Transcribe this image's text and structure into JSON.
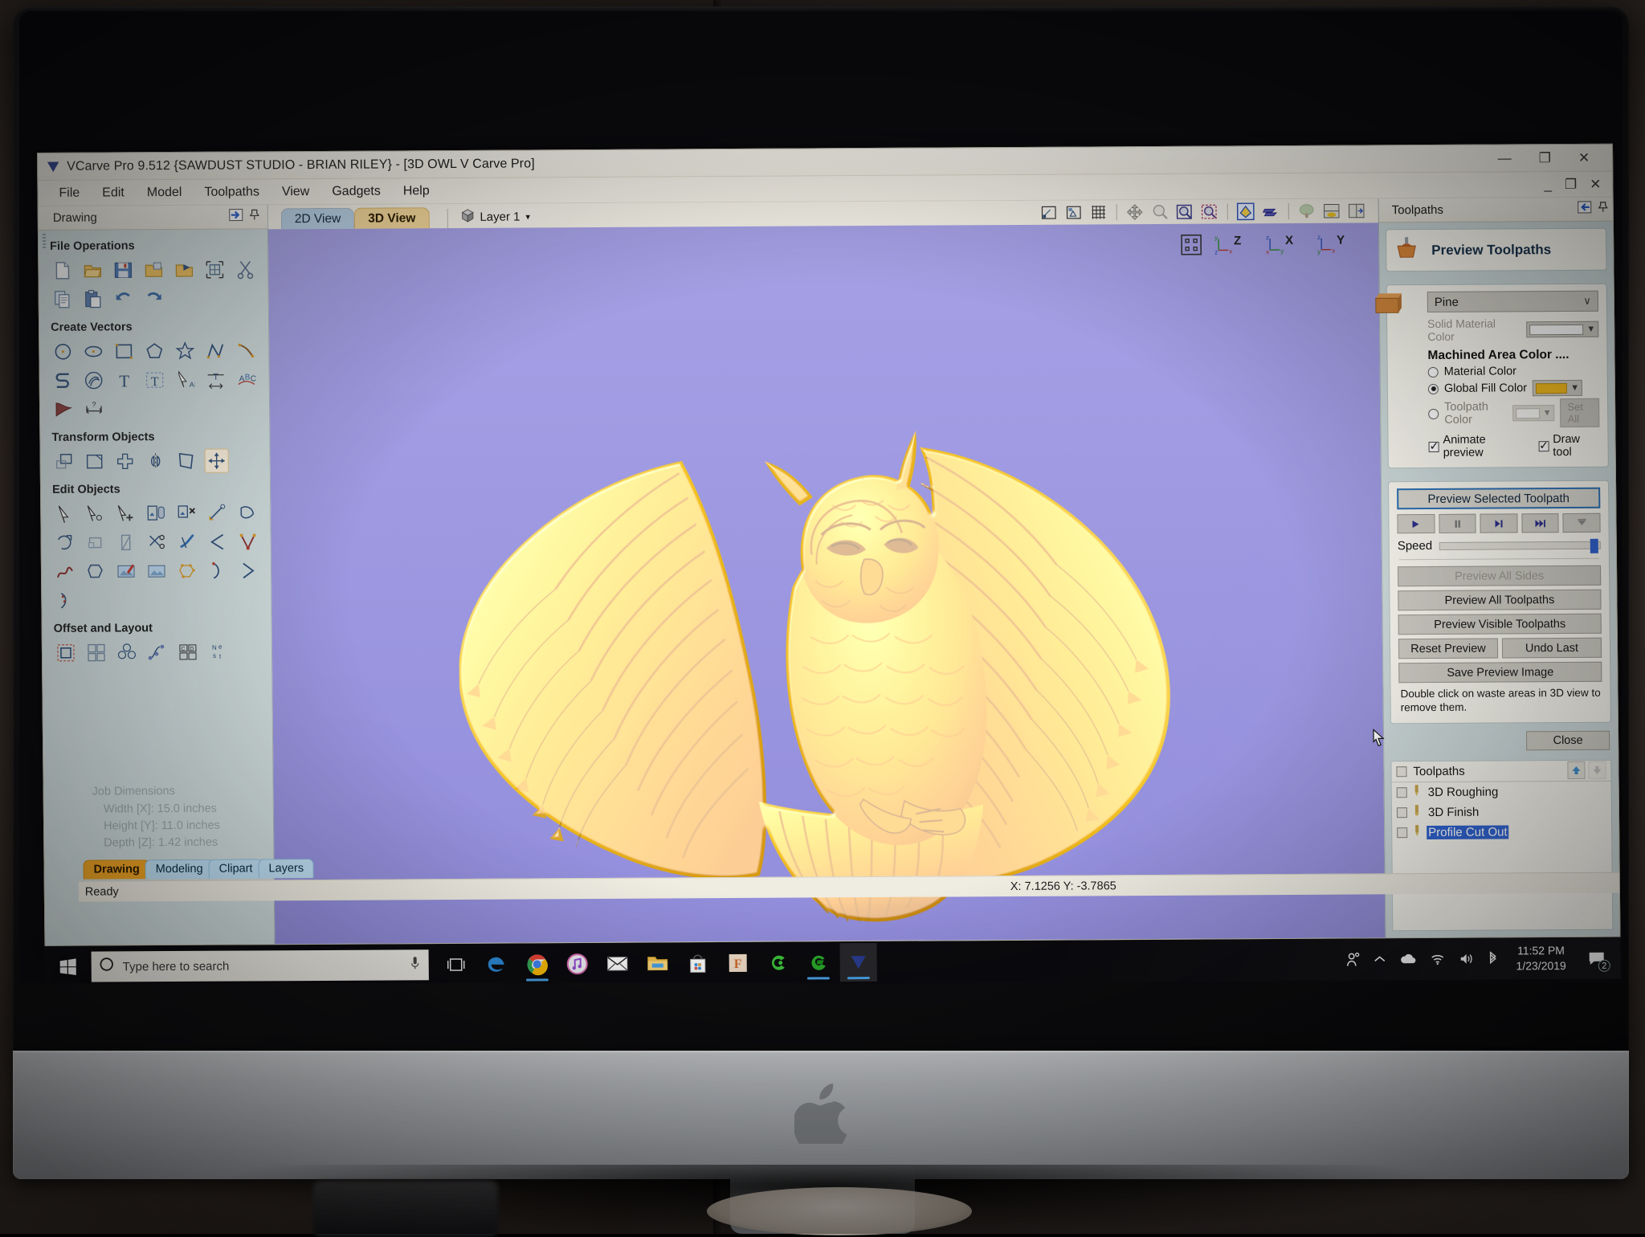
{
  "app": {
    "title": "VCarve Pro 9.512 {SAWDUST STUDIO - BRIAN RILEY} - [3D OWL V Carve Pro]",
    "title_icon": "vcarve-logo-icon",
    "window_buttons": {
      "minimize": "—",
      "restore": "❐",
      "close": "✕"
    },
    "mdi_buttons": {
      "minimize": "_",
      "restore": "❐",
      "close": "✕"
    }
  },
  "menubar": {
    "items": [
      "File",
      "Edit",
      "Model",
      "Toolpaths",
      "View",
      "Gadgets",
      "Help"
    ]
  },
  "left_panel": {
    "header": "Drawing",
    "header_icons": [
      "collapse-panel-icon",
      "pin-icon"
    ],
    "sections": [
      {
        "title": "File Operations",
        "icons": [
          "new-file-icon",
          "open-file-icon",
          "save-file-icon",
          "import-vectors-icon",
          "import-bitmap-icon",
          "job-setup-icon",
          "cut-icon",
          "copy-icon",
          "paste-icon",
          "undo-icon",
          "redo-icon"
        ]
      },
      {
        "title": "Create Vectors",
        "icons": [
          "circle-icon",
          "ellipse-icon",
          "rectangle-icon",
          "polygon-icon",
          "star-icon",
          "polyline-icon",
          "arc-icon",
          "curve-icon",
          "spiral-icon",
          "text-icon",
          "text-box-icon",
          "text-selection-icon",
          "text-on-curve-icon",
          "auto-curve-text-icon",
          "trace-bitmap-icon",
          "dimension-icon"
        ]
      },
      {
        "title": "Transform Objects",
        "icons": [
          "move-icon",
          "scale-icon",
          "rotate-icon",
          "mirror-icon",
          "distort-icon",
          "align-icon"
        ]
      },
      {
        "title": "Edit Objects",
        "icons": [
          "node-edit-icon",
          "node-edit-move-icon",
          "node-add-icon",
          "group-icon",
          "ungroup-icon",
          "measure-icon",
          "join-vectors-icon",
          "close-vector-icon",
          "open-vector-icon",
          "fillet-icon",
          "trim-icon",
          "cut-vector-icon",
          "corner-icon",
          "smooth-node-icon",
          "curve-fit-icon",
          "offset-icon",
          "bitmap-fade-icon",
          "bitmap-crop-icon",
          "nest-nodes-icon",
          "start-point-icon",
          "span-icon",
          "node-tangent-icon"
        ]
      },
      {
        "title": "Offset and Layout",
        "icons": [
          "offset-vectors-icon",
          "array-copy-icon",
          "block-copy-icon",
          "copy-along-curve-icon",
          "plate-layout-icon",
          "nesting-icon"
        ]
      }
    ],
    "job_dimensions": {
      "title": "Job Dimensions",
      "width": "Width  [X]: 15.0 inches",
      "height": "Height [Y]: 11.0 inches",
      "depth": "Depth  [Z]: 1.42 inches"
    },
    "tabs": [
      "Drawing",
      "Modeling",
      "Clipart",
      "Layers"
    ],
    "active_tab": "Drawing"
  },
  "center": {
    "view_tabs": [
      "2D View",
      "3D View"
    ],
    "active_view_tab": "3D View",
    "layer": {
      "label": "Layer 1",
      "icon": "layer-cube-icon",
      "caret": "▾"
    },
    "top_tools": [
      "zoom-box-icon",
      "zoom-drawing-icon",
      "grid-toggle-icon",
      "pan-icon",
      "zoom-tool-icon",
      "zoom-job-icon",
      "zoom-selection-icon",
      "shade-toggle-icon",
      "toolpath-view-icon",
      "material-view-icon",
      "split-view-icon",
      "two-view-icon"
    ],
    "axis_widget": [
      "iso-view-icon",
      "z-view-icon",
      "x-view-icon",
      "y-view-icon"
    ],
    "viewport_bg": "#9b96df",
    "model_color": "#f0c322",
    "model_name": "3D OWL V Carve Pro"
  },
  "right_panel": {
    "header": "Toolpaths",
    "header_icons": [
      "collapse-panel-icon",
      "pin-icon"
    ],
    "form_title": "Preview Toolpaths",
    "form_icon": "toolpath-preview-icon",
    "material": {
      "value": "Pine",
      "caret": "∨"
    },
    "solid_material_color": {
      "label": "Solid Material Color",
      "value": "",
      "swatch": "#ffffff",
      "disabled": true
    },
    "machined_area_color": {
      "title": "Machined Area Color ....",
      "options": [
        {
          "label": "Material Color",
          "selected": false,
          "has_swatch": false
        },
        {
          "label": "Global Fill Color",
          "selected": true,
          "has_swatch": true,
          "swatch": "#f5bb1a"
        },
        {
          "label": "Toolpath Color",
          "selected": false,
          "has_swatch": true,
          "swatch": "#ffffff",
          "disabled": true
        }
      ],
      "set_all_label": "Set All"
    },
    "checkboxes": [
      {
        "label": "Animate preview",
        "checked": true
      },
      {
        "label": "Draw tool",
        "checked": true
      }
    ],
    "preview_selected_label": "Preview Selected Toolpath",
    "transport": [
      "play-icon",
      "pause-icon",
      "step-icon",
      "fast-forward-icon",
      "to-end-icon"
    ],
    "speed": {
      "label": "Speed",
      "value": 100
    },
    "buttons": [
      {
        "label": "Preview All Sides",
        "disabled": true
      },
      {
        "label": "Preview All Toolpaths",
        "disabled": false
      },
      {
        "label": "Preview Visible Toolpaths",
        "disabled": false
      }
    ],
    "button_pair": [
      {
        "label": "Reset Preview"
      },
      {
        "label": "Undo Last"
      }
    ],
    "save_preview_label": "Save Preview Image",
    "hint": "Double click on waste areas in 3D view to remove them.",
    "close_label": "Close",
    "toolpath_list": {
      "header": "Toolpaths",
      "header_checked": false,
      "header_buttons": [
        "move-up-icon",
        "move-down-icon"
      ],
      "items": [
        {
          "name": "3D Roughing",
          "checked": false,
          "selected": false,
          "icon": "endmill-icon"
        },
        {
          "name": "3D Finish",
          "checked": false,
          "selected": false,
          "icon": "ballnose-icon"
        },
        {
          "name": "Profile Cut Out",
          "checked": false,
          "selected": true,
          "icon": "endmill-icon"
        }
      ]
    }
  },
  "status_bar": {
    "message": "Ready",
    "coordinates": "X:  7.1256 Y: -3.7865"
  },
  "taskbar": {
    "start_icon": "windows-start-icon",
    "search": {
      "placeholder": "Type here to search",
      "icons": [
        "search-circle-icon",
        "microphone-icon"
      ]
    },
    "task_view_icon": "task-view-icon",
    "apps": [
      {
        "name": "edge-icon",
        "running": false,
        "active": false
      },
      {
        "name": "chrome-icon",
        "running": true,
        "active": false
      },
      {
        "name": "itunes-icon",
        "running": false,
        "active": false
      },
      {
        "name": "mail-icon",
        "running": false,
        "active": false
      },
      {
        "name": "file-explorer-icon",
        "running": false,
        "active": false
      },
      {
        "name": "microsoft-store-icon",
        "running": false,
        "active": false
      },
      {
        "name": "fusion-app-icon",
        "running": false,
        "active": false
      },
      {
        "name": "carbide-create-icon",
        "running": false,
        "active": false
      },
      {
        "name": "easel-icon",
        "running": true,
        "active": false
      },
      {
        "name": "vcarve-pro-icon",
        "running": true,
        "active": true
      }
    ],
    "tray": [
      "people-icon",
      "show-hidden-icons-icon",
      "onedrive-icon",
      "wifi-icon",
      "volume-icon",
      "bluetooth-icon"
    ],
    "clock": {
      "time": "11:52 PM",
      "date": "1/23/2019"
    },
    "notifications": {
      "icon": "action-center-icon",
      "count": "2"
    }
  }
}
